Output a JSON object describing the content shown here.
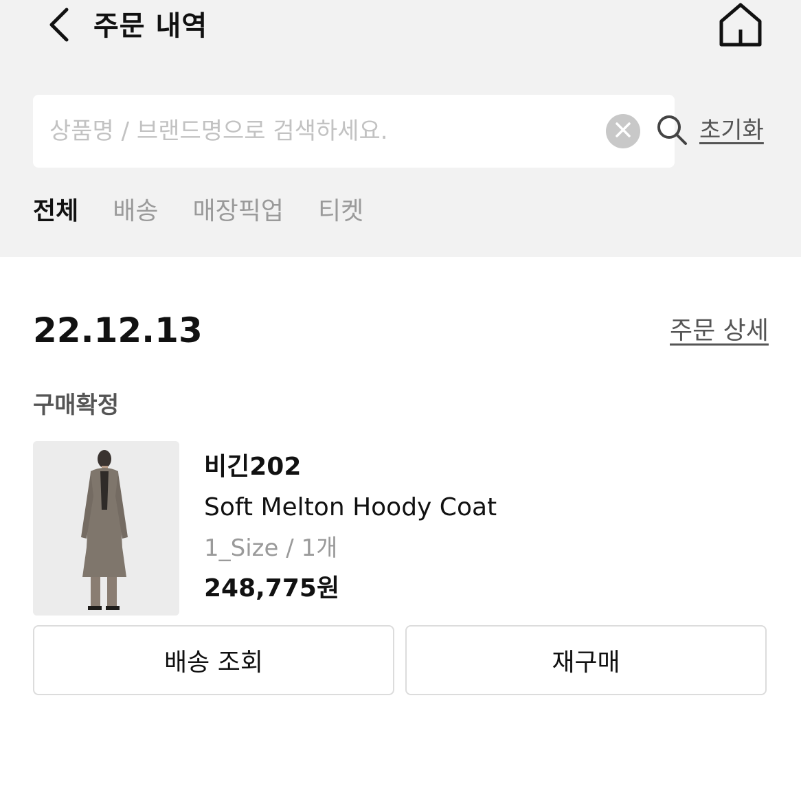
{
  "header": {
    "title": "주문 내역",
    "back_icon": "chevron-left-icon",
    "home_icon": "home-icon"
  },
  "search": {
    "placeholder": "상품명 / 브랜드명으로 검색하세요.",
    "value": "",
    "clear_icon": "clear-icon",
    "search_icon": "search-icon",
    "reset_label": "초기화"
  },
  "tabs": [
    {
      "label": "전체",
      "active": true
    },
    {
      "label": "배송",
      "active": false
    },
    {
      "label": "매장픽업",
      "active": false
    },
    {
      "label": "티켓",
      "active": false
    }
  ],
  "order": {
    "date": "22.12.13",
    "detail_link": "주문 상세",
    "status": "구매확정",
    "item": {
      "brand": "비긴202",
      "name": "Soft Melton Hoody Coat",
      "option": "1_Size / 1개",
      "price": "248,775원"
    },
    "buttons": {
      "track": "배송 조회",
      "reorder": "재구매"
    }
  },
  "colors": {
    "header_bg": "#f2f2f2",
    "text_primary": "#111111",
    "text_muted": "#9a9a9a",
    "border": "#dcdcdc"
  }
}
